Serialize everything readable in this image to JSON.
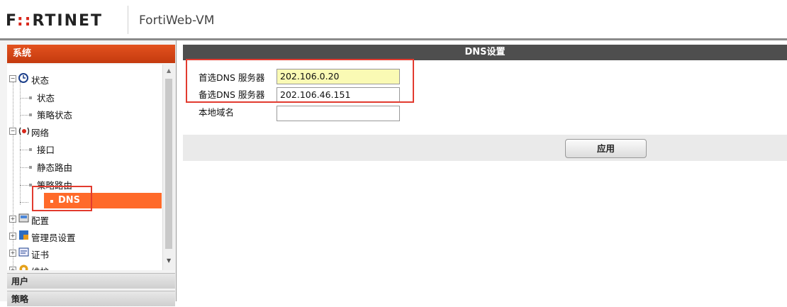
{
  "header": {
    "logo_parts": [
      "F",
      "::",
      "RTINET"
    ],
    "product": "FortiWeb-VM"
  },
  "sidebar": {
    "section_title": "系统",
    "tree": [
      {
        "label": "状态",
        "icon": "status-icon",
        "expanded": true,
        "children": [
          "状态",
          "策略状态"
        ]
      },
      {
        "label": "网络",
        "icon": "network-icon",
        "expanded": true,
        "children": [
          "接口",
          "静态路由",
          "策略路由",
          "DNS"
        ]
      },
      {
        "label": "配置",
        "icon": "config-icon",
        "expanded": false
      },
      {
        "label": "管理员设置",
        "icon": "admin-icon",
        "expanded": false
      },
      {
        "label": "证书",
        "icon": "certificate-icon",
        "expanded": false
      },
      {
        "label": "维护",
        "icon": "maintenance-icon",
        "expanded": false
      }
    ],
    "selected": "DNS",
    "bottom_sections": [
      "用户",
      "策略"
    ]
  },
  "main": {
    "title": "DNS设置",
    "fields": [
      {
        "label": "首选DNS 服务器",
        "value": "202.106.0.20",
        "highlighted": true
      },
      {
        "label": "备选DNS 服务器",
        "value": "202.106.46.151",
        "highlighted": false
      },
      {
        "label": "本地域名",
        "value": "",
        "highlighted": false
      }
    ],
    "apply_label": "应用"
  },
  "colors": {
    "accent": "#e3521f",
    "selection": "#ff6a2a",
    "annotation": "#e23b2f",
    "title_bar": "#4e4e4e"
  }
}
